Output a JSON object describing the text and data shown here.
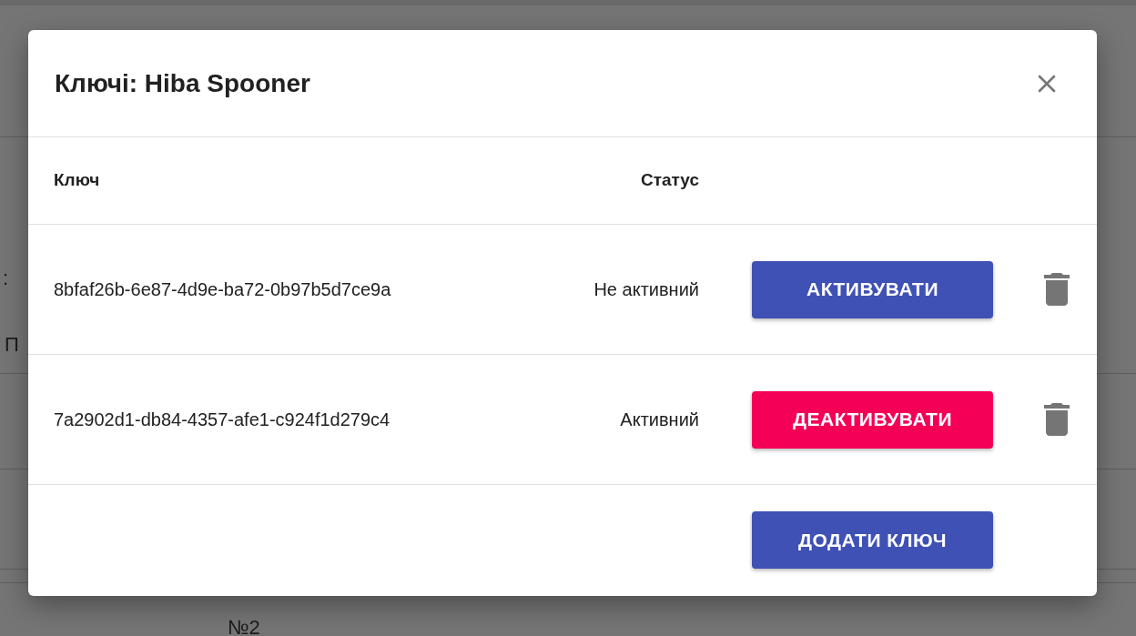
{
  "background": {
    "texts": [
      ":",
      "П",
      "№2"
    ]
  },
  "dialog": {
    "title": "Ключі: Hiba Spooner",
    "columns": [
      "Ключ",
      "Статус"
    ],
    "rows": [
      {
        "key": "8bfaf26b-6e87-4d9e-ba72-0b97b5d7ce9a",
        "status": "Не активний",
        "active": false,
        "button": "АКТИВУВАТИ"
      },
      {
        "key": "7a2902d1-db84-4357-afe1-c924f1d279c4",
        "status": "Активний",
        "active": true,
        "button": "ДЕАКТИВУВАТИ"
      }
    ],
    "add_button": "ДОДАТИ КЛЮЧ"
  }
}
